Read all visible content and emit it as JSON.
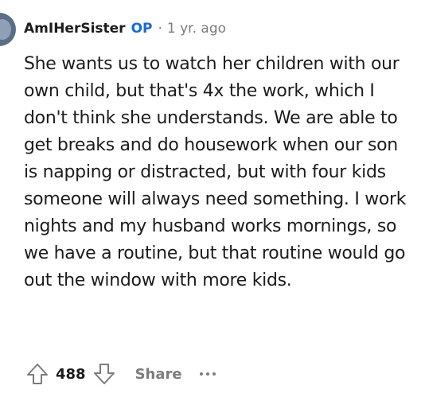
{
  "comment": {
    "author": "AmIHerSister",
    "op_badge": "OP",
    "separator": "·",
    "timestamp": "1 yr. ago",
    "body": "She wants us to watch her children with our own child, but that's 4x the work, which I don't think she understands. We are able to get breaks and do housework when our son is napping or distracted, but with four kids someone will always need something. I work nights and my husband works mornings, so we have a routine, but that routine would go out the window with more kids.",
    "score": "488",
    "share_label": "Share",
    "icons": {
      "upvote": "upvote-arrow-icon",
      "downvote": "downvote-arrow-icon",
      "more": "more-options-icon"
    }
  },
  "colors": {
    "op_badge": "#1a6ad6",
    "text": "#1c1c1c",
    "meta": "#7c7c7c",
    "avatar": "#5b6e86"
  }
}
